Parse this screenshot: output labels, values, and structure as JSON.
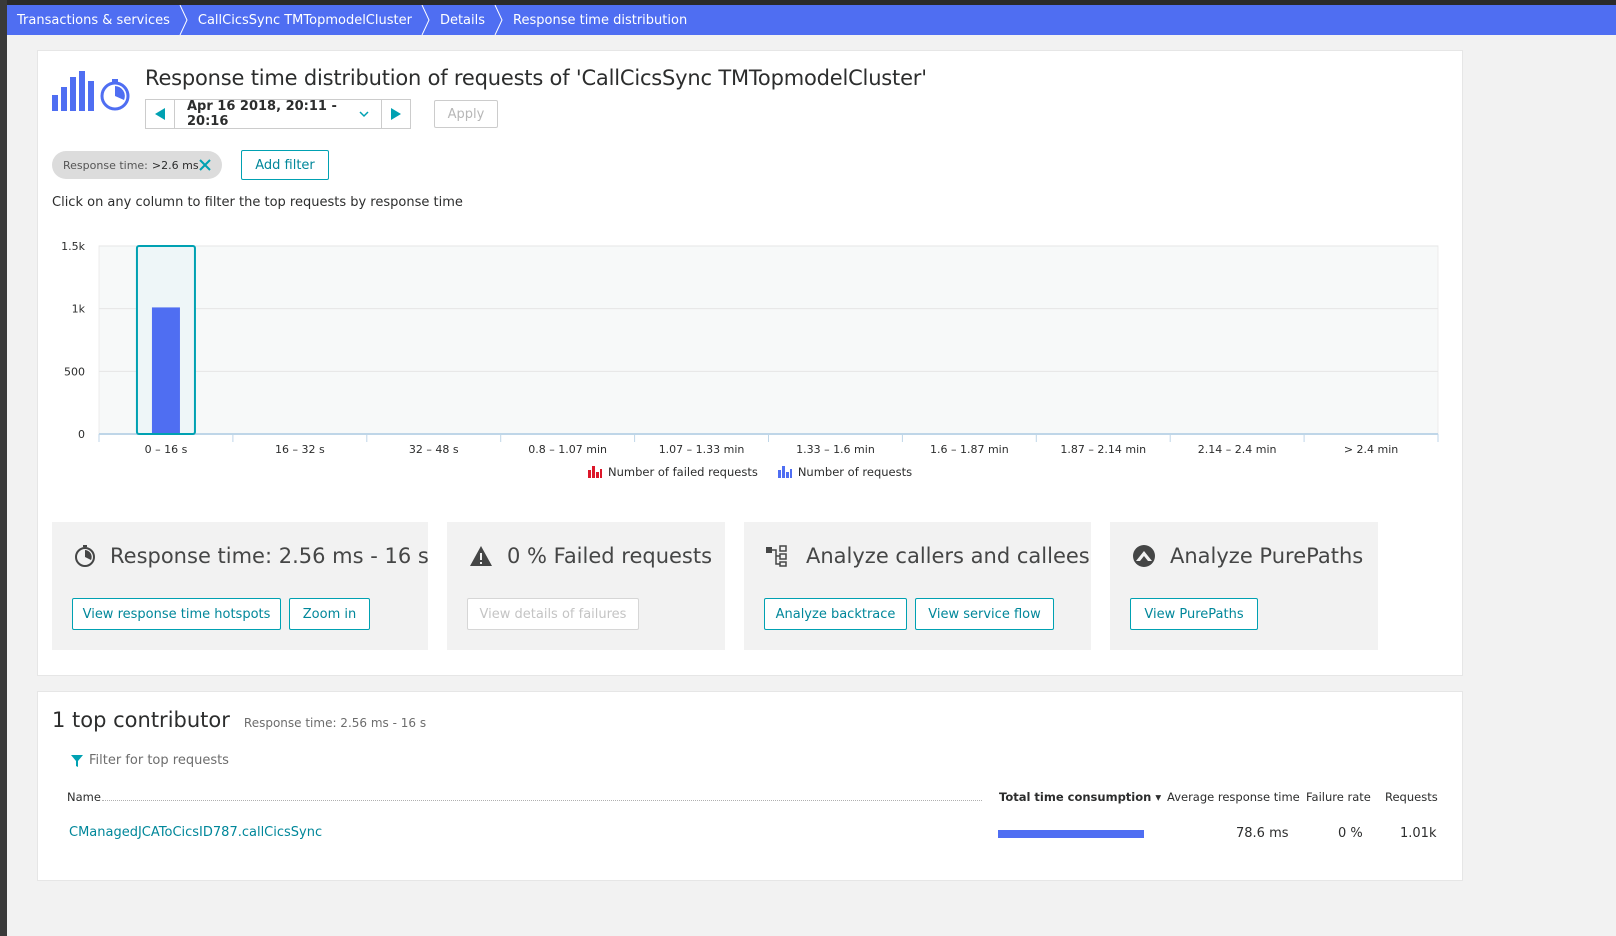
{
  "breadcrumb": [
    {
      "label": "Transactions & services"
    },
    {
      "label": "CallCicsSync TMTopmodelCluster"
    },
    {
      "label": "Details"
    },
    {
      "label": "Response time distribution"
    }
  ],
  "header": {
    "title": "Response time distribution of requests of 'CallCicsSync TMTopmodelCluster'",
    "timeframe": "Apr 16 2018, 20:11 - 20:16",
    "apply_label": "Apply"
  },
  "filters": {
    "chip_key": "Response time:",
    "chip_value": ">2.6 ms",
    "add_filter_label": "Add filter"
  },
  "hint": "Click on any column to filter the top requests by response time",
  "chart_data": {
    "type": "bar",
    "categories": [
      "0 – 16 s",
      "16 – 32 s",
      "32 – 48 s",
      "0.8 – 1.07 min",
      "1.07 – 1.33 min",
      "1.33 – 1.6 min",
      "1.6 – 1.87 min",
      "1.87 – 2.14 min",
      "2.14 – 2.4 min",
      "> 2.4 min"
    ],
    "series": [
      {
        "name": "Number of failed requests",
        "values": [
          0,
          0,
          0,
          0,
          0,
          0,
          0,
          0,
          0,
          0
        ],
        "color": "#dc172a"
      },
      {
        "name": "Number of requests",
        "values": [
          1010,
          0,
          0,
          0,
          0,
          0,
          0,
          0,
          0,
          0
        ],
        "color": "#4f6ef2"
      }
    ],
    "yticks": [
      "0",
      "500",
      "1k",
      "1.5k"
    ],
    "ylim": [
      0,
      1500
    ],
    "selected_category": "0 – 16 s",
    "grid": true,
    "legend_position": "bottom"
  },
  "tiles": [
    {
      "title": "Response time: 2.56 ms - 16 s",
      "icon": "stopwatch-icon",
      "buttons": [
        "View response time hotspots",
        "Zoom in"
      ]
    },
    {
      "title": "0 % Failed requests",
      "icon": "warning-icon",
      "buttons": [
        "View details of failures"
      ]
    },
    {
      "title": "Analyze callers and callees",
      "icon": "service-flow-icon",
      "buttons": [
        "Analyze backtrace",
        "View service flow"
      ]
    },
    {
      "title": "Analyze PurePaths",
      "icon": "purepath-icon",
      "buttons": [
        "View PurePaths"
      ]
    }
  ],
  "contributors": {
    "heading": "1 top contributor",
    "subheading": "Response time: 2.56 ms - 16 s",
    "filter_label": "Filter for top requests",
    "columns": {
      "name": "Name",
      "total_time": "Total time consumption ▾",
      "avg_response": "Average response time",
      "failure_rate": "Failure rate",
      "requests": "Requests"
    },
    "rows": [
      {
        "name": "CManagedJCAToCicsID787.callCicsSync",
        "total_time_share": 1.0,
        "avg_response": "78.6 ms",
        "failure_rate": "0 %",
        "requests": "1.01k"
      }
    ]
  },
  "colors": {
    "accent": "#4f6ef2",
    "link": "#00879a",
    "button_border": "#00a1b2",
    "failed": "#dc172a"
  }
}
